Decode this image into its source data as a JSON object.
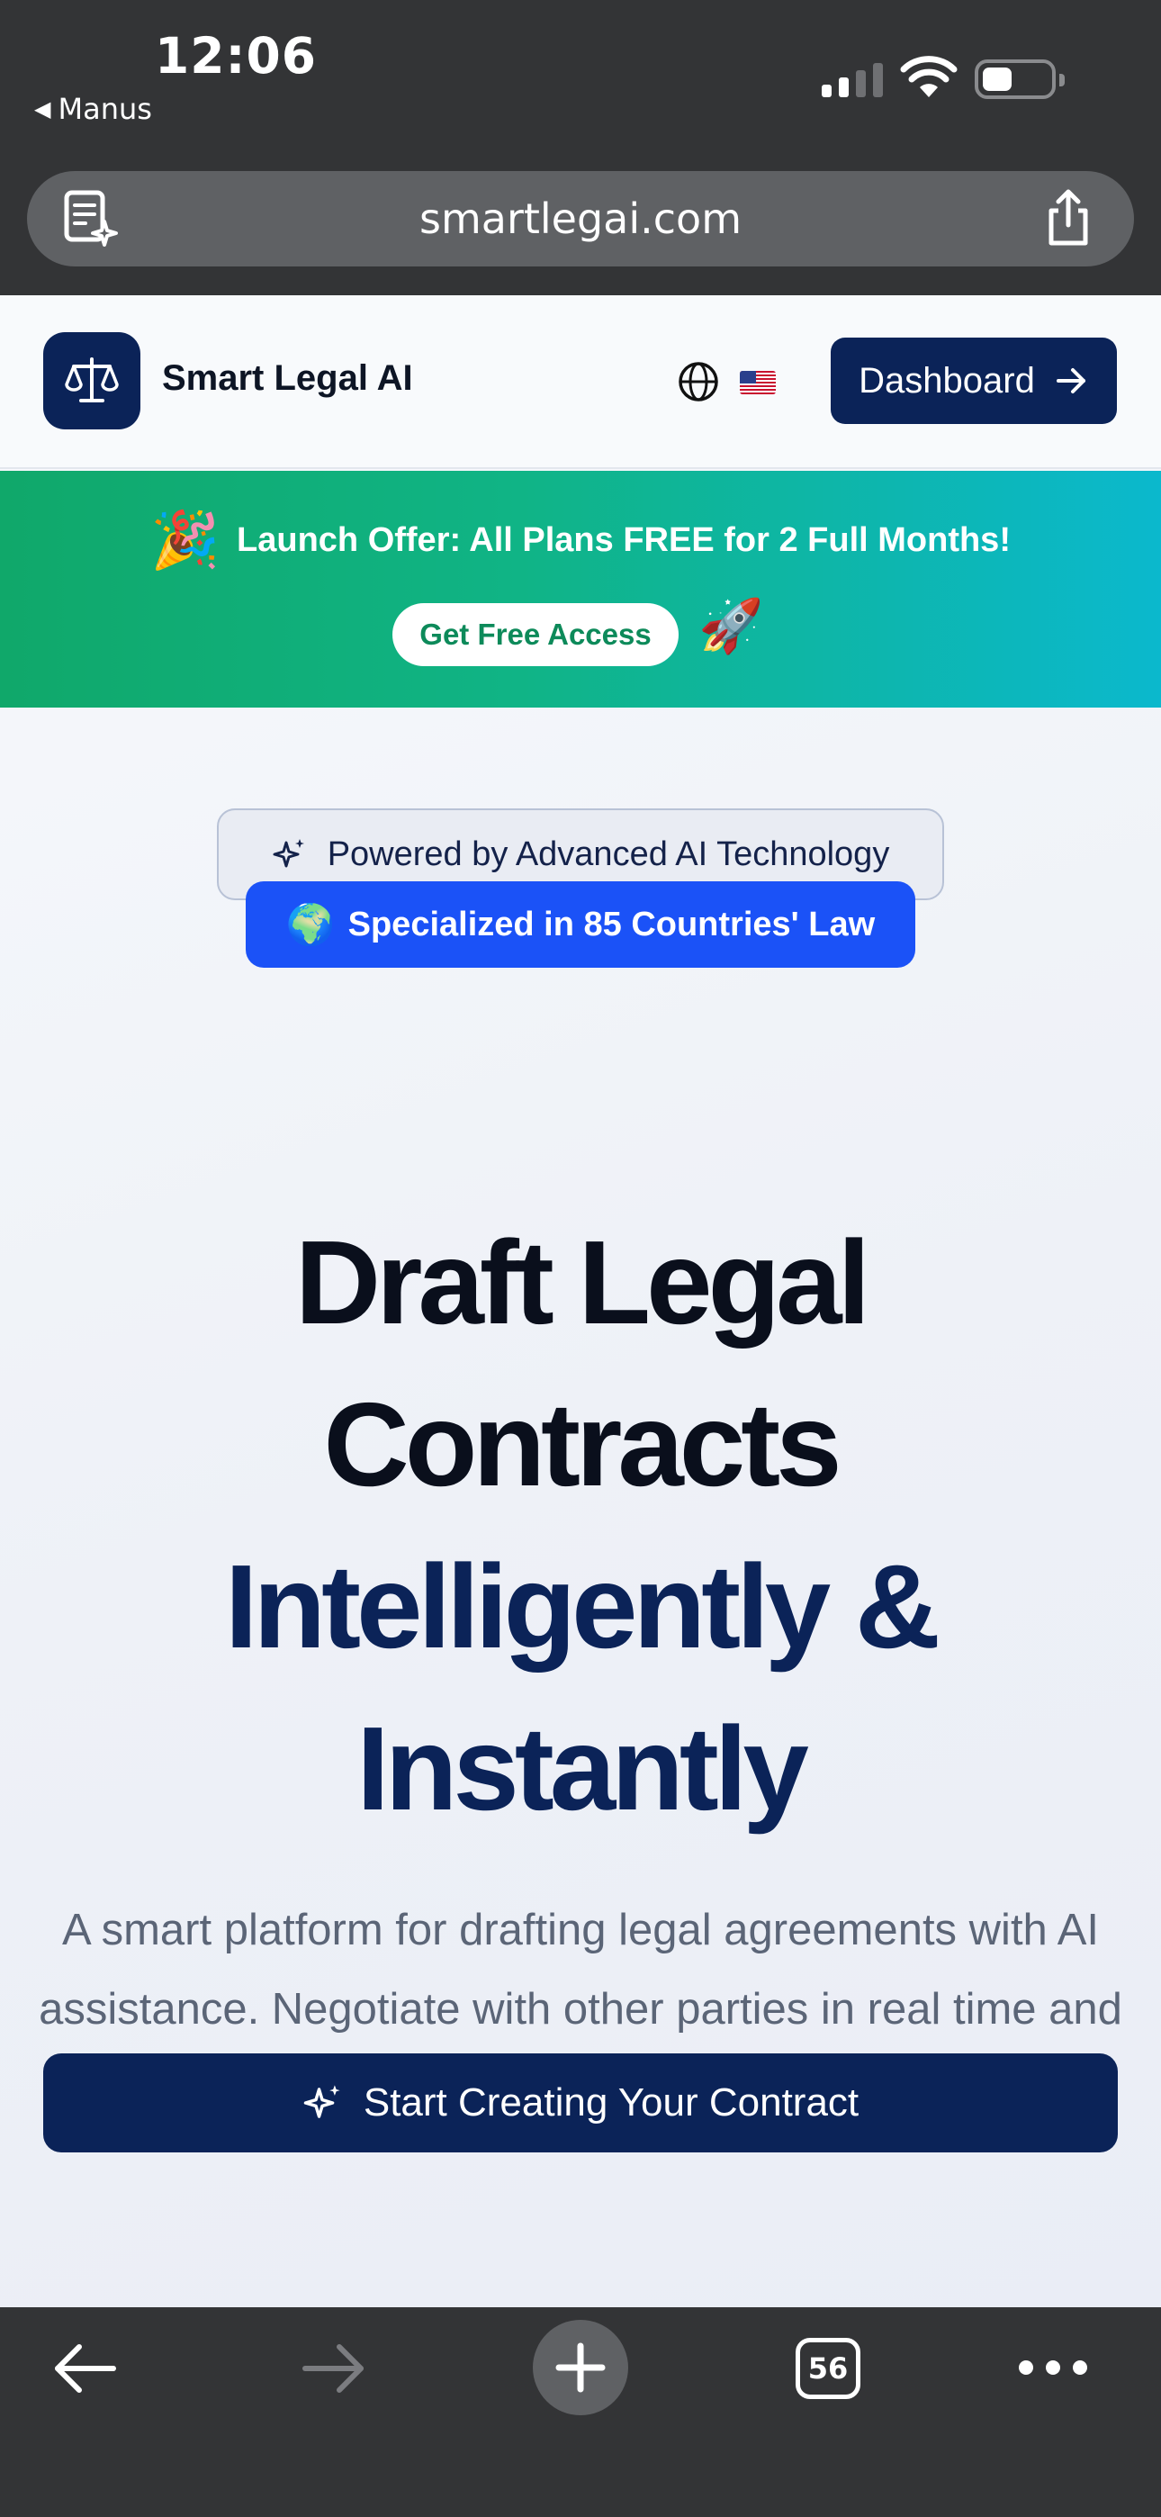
{
  "status_bar": {
    "time": "12:06",
    "back_app": "Manus",
    "back_app_icon": "triangle-left-icon",
    "signal_icon": "cellular-signal-icon",
    "wifi_icon": "wifi-icon",
    "battery_icon": "battery-icon"
  },
  "address_bar": {
    "url": "smartlegai.com",
    "left_icon": "reader-ai-icon",
    "right_icon": "share-icon"
  },
  "header": {
    "brand": "Smart Legal AI",
    "logo_icon": "scales-icon",
    "language_icon": "globe-icon",
    "flag_icon": "us-flag-icon",
    "dashboard_label": "Dashboard",
    "dashboard_icon": "arrow-right-icon",
    "brand_color": "#0b2358"
  },
  "promo": {
    "emoji_left": "🎉",
    "text": "Launch Offer: All Plans FREE for 2 Full Months!",
    "cta_label": "Get Free Access",
    "emoji_right": "🚀",
    "gradient": [
      "#10a86a",
      "#0bb8cd"
    ]
  },
  "hero": {
    "badge_ai": "Powered by Advanced AI Technology",
    "badge_ai_icon": "sparkles-icon",
    "badge_country_emoji": "🌍",
    "badge_country": "Specialized in 85 Countries' Law",
    "badge_country_color": "#1b52f7",
    "headline_line1": "Draft Legal",
    "headline_line2": "Contracts",
    "headline_line3": "Intelligently &",
    "headline_line4": "Instantly",
    "subtext": "A smart platform for drafting legal agreements with AI assistance. Negotiate with other parties in real time and get professional contracts in minutes.",
    "cta_label": "Start Creating Your Contract",
    "cta_icon": "sparkles-icon"
  },
  "toolbar": {
    "back_icon": "arrow-left-icon",
    "forward_icon": "arrow-right-disabled-icon",
    "new_tab_icon": "plus-icon",
    "tabs_count": "56",
    "more_icon": "ellipsis-icon"
  }
}
